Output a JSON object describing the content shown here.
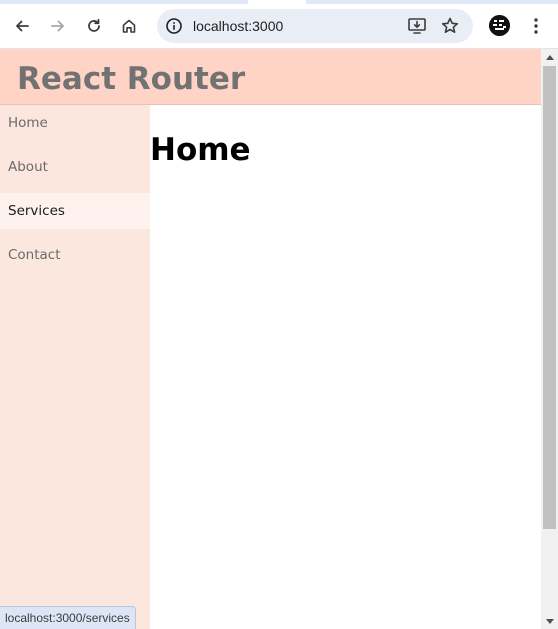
{
  "browser": {
    "url": "localhost:3000",
    "status_url": "localhost:3000/services"
  },
  "app": {
    "title": "React Router",
    "colors": {
      "header_bg": "#ffd4c6",
      "sidebar_bg": "#fbe7de",
      "active_item_bg": "#fdf2ee",
      "title_color": "#727272"
    }
  },
  "sidebar": {
    "items": [
      {
        "label": "Home",
        "active": false
      },
      {
        "label": "About",
        "active": false
      },
      {
        "label": "Services",
        "active": true
      },
      {
        "label": "Contact",
        "active": false
      }
    ]
  },
  "main": {
    "heading": "Home"
  },
  "icons": {
    "back": "arrow-left-icon",
    "forward": "arrow-right-icon",
    "reload": "reload-icon",
    "home": "home-icon",
    "site_info": "info-icon",
    "install": "install-app-icon",
    "bookmark": "star-icon",
    "menu": "kebab-menu-icon"
  }
}
